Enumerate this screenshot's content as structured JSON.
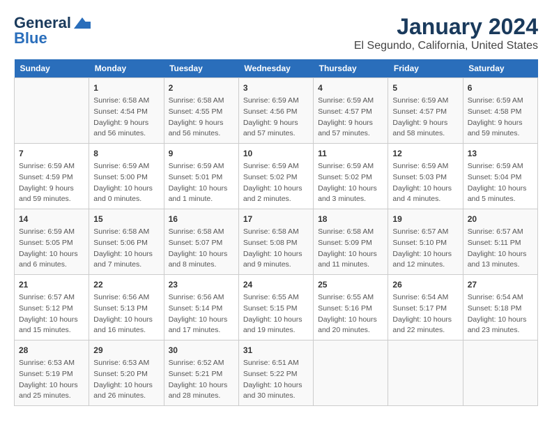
{
  "header": {
    "logo_line1": "General",
    "logo_line2": "Blue",
    "main_title": "January 2024",
    "sub_title": "El Segundo, California, United States"
  },
  "calendar": {
    "days_of_week": [
      "Sunday",
      "Monday",
      "Tuesday",
      "Wednesday",
      "Thursday",
      "Friday",
      "Saturday"
    ],
    "weeks": [
      [
        {
          "day": "",
          "info": ""
        },
        {
          "day": "1",
          "info": "Sunrise: 6:58 AM\nSunset: 4:54 PM\nDaylight: 9 hours\nand 56 minutes."
        },
        {
          "day": "2",
          "info": "Sunrise: 6:58 AM\nSunset: 4:55 PM\nDaylight: 9 hours\nand 56 minutes."
        },
        {
          "day": "3",
          "info": "Sunrise: 6:59 AM\nSunset: 4:56 PM\nDaylight: 9 hours\nand 57 minutes."
        },
        {
          "day": "4",
          "info": "Sunrise: 6:59 AM\nSunset: 4:57 PM\nDaylight: 9 hours\nand 57 minutes."
        },
        {
          "day": "5",
          "info": "Sunrise: 6:59 AM\nSunset: 4:57 PM\nDaylight: 9 hours\nand 58 minutes."
        },
        {
          "day": "6",
          "info": "Sunrise: 6:59 AM\nSunset: 4:58 PM\nDaylight: 9 hours\nand 59 minutes."
        }
      ],
      [
        {
          "day": "7",
          "info": "Sunrise: 6:59 AM\nSunset: 4:59 PM\nDaylight: 9 hours\nand 59 minutes."
        },
        {
          "day": "8",
          "info": "Sunrise: 6:59 AM\nSunset: 5:00 PM\nDaylight: 10 hours\nand 0 minutes."
        },
        {
          "day": "9",
          "info": "Sunrise: 6:59 AM\nSunset: 5:01 PM\nDaylight: 10 hours\nand 1 minute."
        },
        {
          "day": "10",
          "info": "Sunrise: 6:59 AM\nSunset: 5:02 PM\nDaylight: 10 hours\nand 2 minutes."
        },
        {
          "day": "11",
          "info": "Sunrise: 6:59 AM\nSunset: 5:02 PM\nDaylight: 10 hours\nand 3 minutes."
        },
        {
          "day": "12",
          "info": "Sunrise: 6:59 AM\nSunset: 5:03 PM\nDaylight: 10 hours\nand 4 minutes."
        },
        {
          "day": "13",
          "info": "Sunrise: 6:59 AM\nSunset: 5:04 PM\nDaylight: 10 hours\nand 5 minutes."
        }
      ],
      [
        {
          "day": "14",
          "info": "Sunrise: 6:59 AM\nSunset: 5:05 PM\nDaylight: 10 hours\nand 6 minutes."
        },
        {
          "day": "15",
          "info": "Sunrise: 6:58 AM\nSunset: 5:06 PM\nDaylight: 10 hours\nand 7 minutes."
        },
        {
          "day": "16",
          "info": "Sunrise: 6:58 AM\nSunset: 5:07 PM\nDaylight: 10 hours\nand 8 minutes."
        },
        {
          "day": "17",
          "info": "Sunrise: 6:58 AM\nSunset: 5:08 PM\nDaylight: 10 hours\nand 9 minutes."
        },
        {
          "day": "18",
          "info": "Sunrise: 6:58 AM\nSunset: 5:09 PM\nDaylight: 10 hours\nand 11 minutes."
        },
        {
          "day": "19",
          "info": "Sunrise: 6:57 AM\nSunset: 5:10 PM\nDaylight: 10 hours\nand 12 minutes."
        },
        {
          "day": "20",
          "info": "Sunrise: 6:57 AM\nSunset: 5:11 PM\nDaylight: 10 hours\nand 13 minutes."
        }
      ],
      [
        {
          "day": "21",
          "info": "Sunrise: 6:57 AM\nSunset: 5:12 PM\nDaylight: 10 hours\nand 15 minutes."
        },
        {
          "day": "22",
          "info": "Sunrise: 6:56 AM\nSunset: 5:13 PM\nDaylight: 10 hours\nand 16 minutes."
        },
        {
          "day": "23",
          "info": "Sunrise: 6:56 AM\nSunset: 5:14 PM\nDaylight: 10 hours\nand 17 minutes."
        },
        {
          "day": "24",
          "info": "Sunrise: 6:55 AM\nSunset: 5:15 PM\nDaylight: 10 hours\nand 19 minutes."
        },
        {
          "day": "25",
          "info": "Sunrise: 6:55 AM\nSunset: 5:16 PM\nDaylight: 10 hours\nand 20 minutes."
        },
        {
          "day": "26",
          "info": "Sunrise: 6:54 AM\nSunset: 5:17 PM\nDaylight: 10 hours\nand 22 minutes."
        },
        {
          "day": "27",
          "info": "Sunrise: 6:54 AM\nSunset: 5:18 PM\nDaylight: 10 hours\nand 23 minutes."
        }
      ],
      [
        {
          "day": "28",
          "info": "Sunrise: 6:53 AM\nSunset: 5:19 PM\nDaylight: 10 hours\nand 25 minutes."
        },
        {
          "day": "29",
          "info": "Sunrise: 6:53 AM\nSunset: 5:20 PM\nDaylight: 10 hours\nand 26 minutes."
        },
        {
          "day": "30",
          "info": "Sunrise: 6:52 AM\nSunset: 5:21 PM\nDaylight: 10 hours\nand 28 minutes."
        },
        {
          "day": "31",
          "info": "Sunrise: 6:51 AM\nSunset: 5:22 PM\nDaylight: 10 hours\nand 30 minutes."
        },
        {
          "day": "",
          "info": ""
        },
        {
          "day": "",
          "info": ""
        },
        {
          "day": "",
          "info": ""
        }
      ]
    ]
  }
}
